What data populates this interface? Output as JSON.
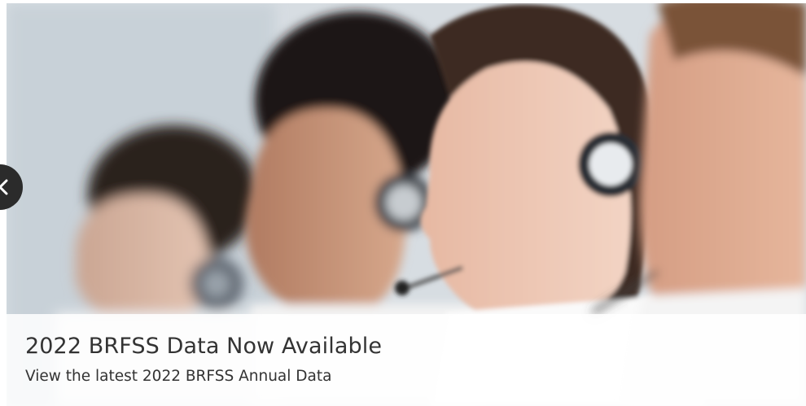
{
  "carousel": {
    "slide": {
      "image_alt": "Call center agents wearing headsets",
      "title": "2022 BRFSS Data Now Available",
      "subtitle": "View the latest 2022 BRFSS Annual Data"
    },
    "prev_icon": "chevron-left-icon"
  }
}
